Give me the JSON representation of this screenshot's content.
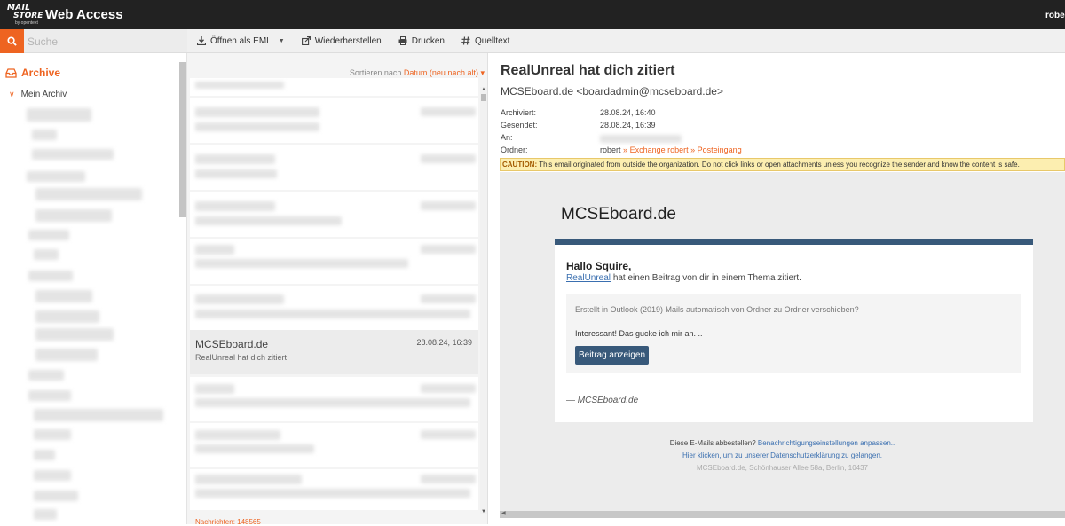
{
  "app": {
    "logo_line1": "MAIL",
    "logo_line2": "STORE",
    "logo_line3": "by opentext",
    "title": "Web Access",
    "user": "robert"
  },
  "search": {
    "placeholder": "Suche"
  },
  "toolbar": {
    "open_eml": "Öffnen als EML",
    "restore": "Wiederherstellen",
    "print": "Drucken",
    "source": "Quelltext"
  },
  "sidebar": {
    "archive_label": "Archive",
    "root_folder": "Mein Archiv"
  },
  "list": {
    "sort_label": "Sortieren nach",
    "sort_value": "Datum (neu nach alt)",
    "selected_message": {
      "from": "MCSEboard.de",
      "date": "28.08.24, 16:39",
      "subject": "RealUnreal hat dich zitiert"
    },
    "count_text": "Nachrichten: 148565"
  },
  "reader": {
    "subject": "RealUnreal hat dich zitiert",
    "sender": "MCSEboard.de <boardadmin@mcseboard.de>",
    "archived_label": "Archiviert:",
    "archived_value": "28.08.24, 16:40",
    "sent_label": "Gesendet:",
    "sent_value": "28.08.24, 16:39",
    "to_label": "An:",
    "folder_label": "Ordner:",
    "folder_user": "robert",
    "folder_path1": "Exchange robert",
    "folder_path2": "Posteingang",
    "caution_label": "CAUTION:",
    "caution_text": "This email originated from outside the organization. Do not click links or open attachments unless you recognize the sender and know the content is safe."
  },
  "mail": {
    "brand": "MCSEboard.de",
    "greeting": "Hallo Squire,",
    "cited_user": "RealUnreal",
    "cited_text": "hat einen Beitrag von dir in einem Thema zitiert.",
    "quote_title": "Erstellt in Outlook (2019) Mails automatisch von Ordner zu Ordner verschieben?",
    "quote_text": "Interessant! Das gucke ich mir an. ..",
    "button": "Beitrag anzeigen",
    "signature": "— MCSEboard.de",
    "footer_unsub": "Diese E-Mails abbestellen?",
    "footer_settings": "Benachrichtigungseinstellungen anpassen..",
    "footer_privacy": "Hier klicken, um zu unserer Datenschutzerklärung zu gelangen.",
    "footer_address": "MCSEboard.de, Schönhauser Allee 58a, Berlin, 10437"
  },
  "colors": {
    "accent": "#ee6421",
    "topbar": "#222222",
    "mail_header_blue": "#38597a",
    "link_blue": "#3a6fb0",
    "caution_bg": "#fceeb0"
  },
  "icons": [
    "search-icon",
    "download-icon",
    "restore-icon",
    "print-icon",
    "hash-icon",
    "inbox-icon",
    "chevron-down-icon"
  ]
}
